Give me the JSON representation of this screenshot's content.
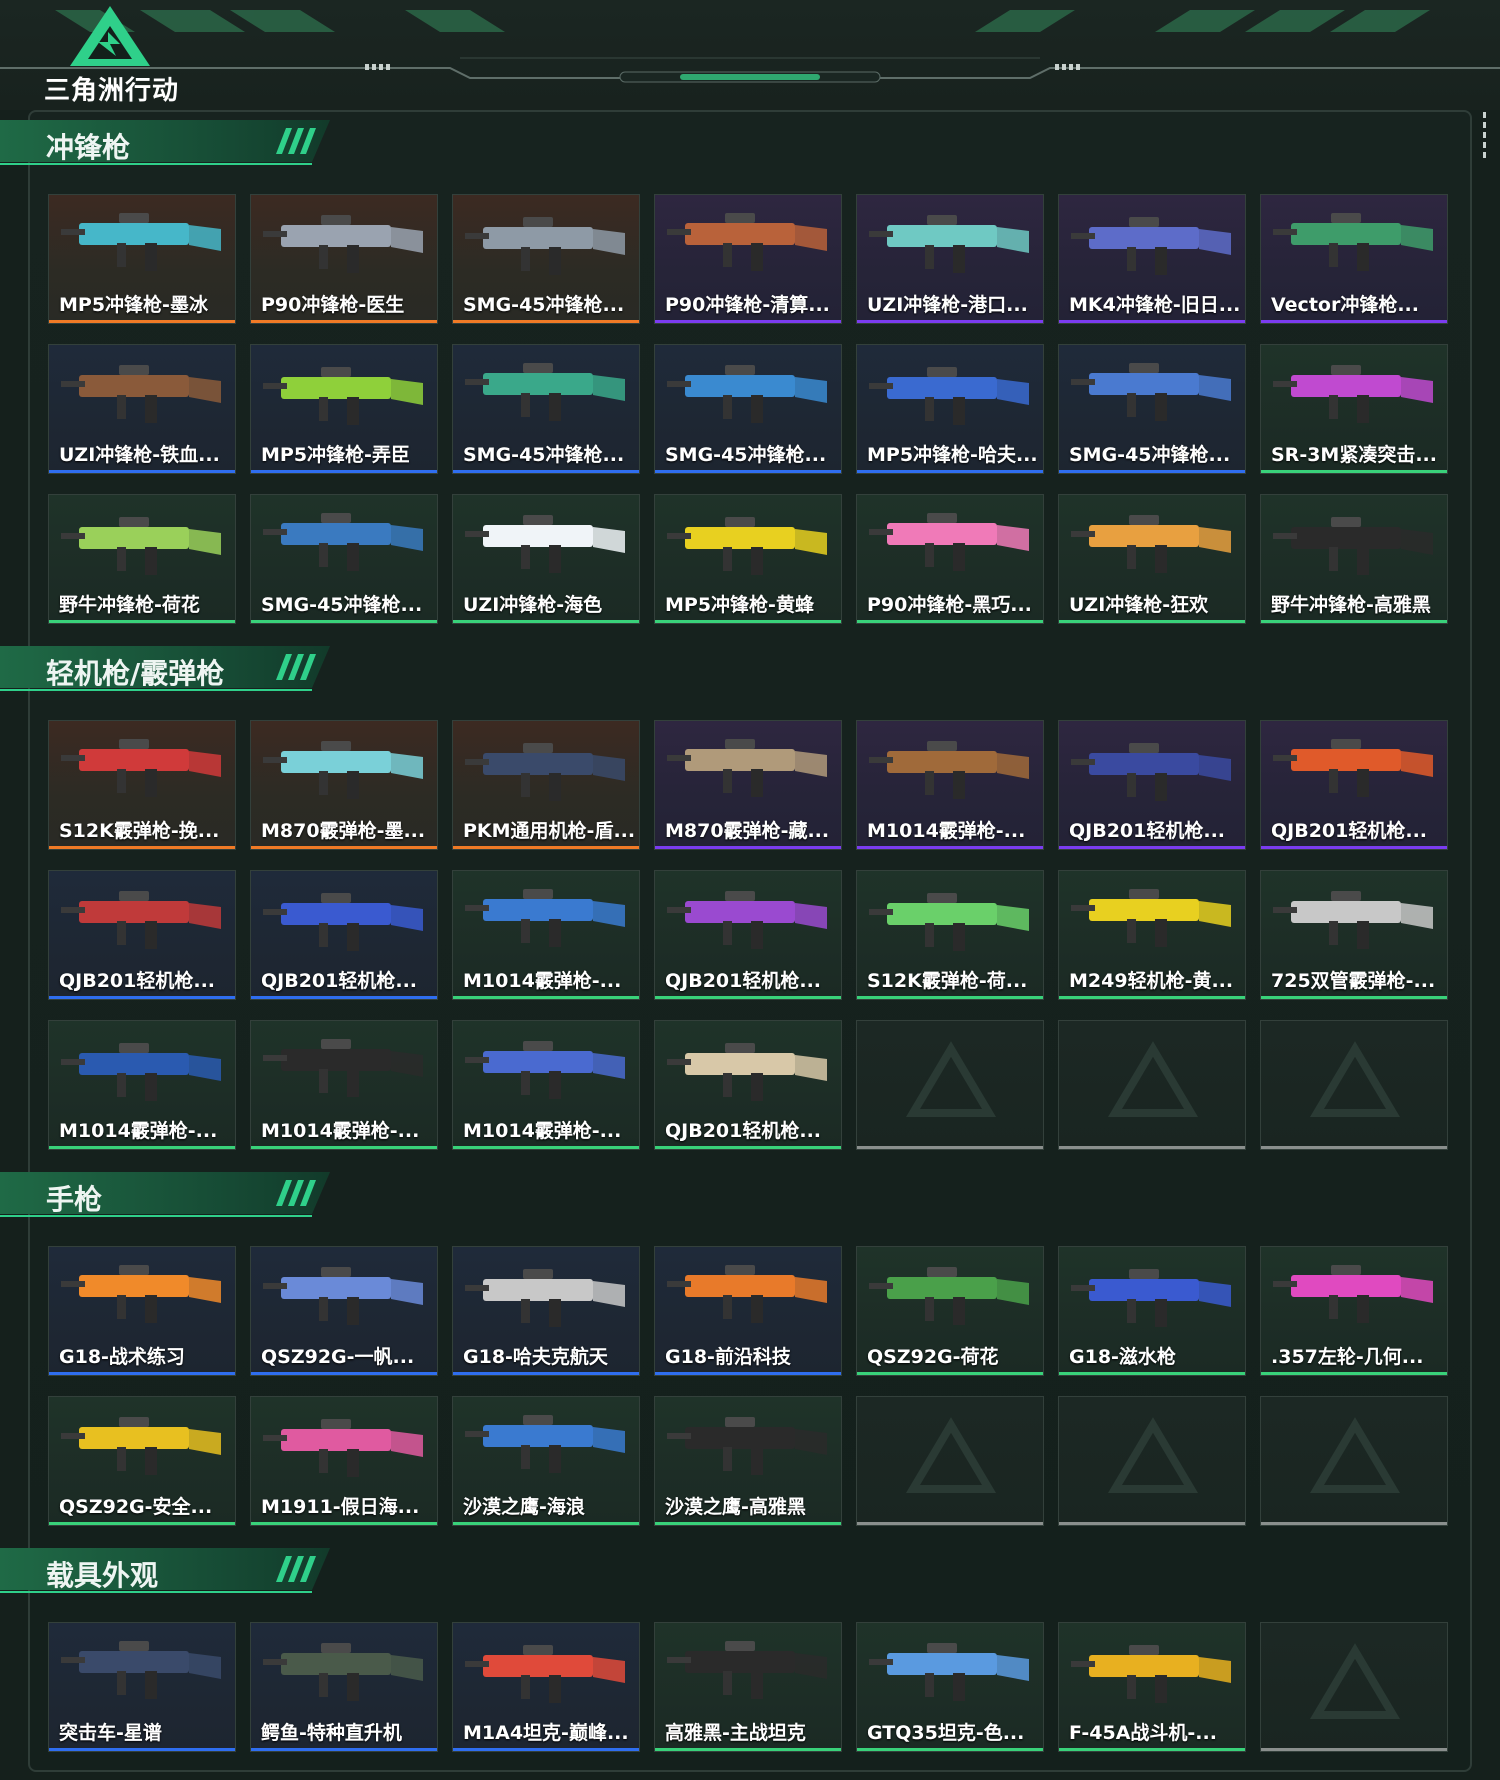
{
  "brand": {
    "logo_text": "三角洲行动"
  },
  "sections": [
    {
      "title": "冲锋枪",
      "items": [
        {
          "label": "MP5冲锋枪-墨冰",
          "rarity": "orange",
          "color": "#46b7c9"
        },
        {
          "label": "P90冲锋枪-医生",
          "rarity": "orange",
          "color": "#9aa3b0"
        },
        {
          "label": "SMG-45冲锋枪...",
          "rarity": "orange",
          "color": "#8e9aa6"
        },
        {
          "label": "P90冲锋枪-清算...",
          "rarity": "purple",
          "color": "#b9623a"
        },
        {
          "label": "UZI冲锋枪-港口...",
          "rarity": "purple",
          "color": "#6fc9c3"
        },
        {
          "label": "MK4冲锋枪-旧日...",
          "rarity": "purple",
          "color": "#5d6cc9"
        },
        {
          "label": "Vector冲锋枪...",
          "rarity": "purple",
          "color": "#3e9c6a"
        },
        {
          "label": "UZI冲锋枪-铁血...",
          "rarity": "blue",
          "color": "#8a5a3a"
        },
        {
          "label": "MP5冲锋枪-弄臣",
          "rarity": "blue",
          "color": "#8fd03a"
        },
        {
          "label": "SMG-45冲锋枪...",
          "rarity": "blue",
          "color": "#3aa88a"
        },
        {
          "label": "SMG-45冲锋枪...",
          "rarity": "blue",
          "color": "#3a8ad0"
        },
        {
          "label": "MP5冲锋枪-哈夫...",
          "rarity": "blue",
          "color": "#3a6ad0"
        },
        {
          "label": "SMG-45冲锋枪...",
          "rarity": "blue",
          "color": "#4a7ad0"
        },
        {
          "label": "SR-3M紧凑突击...",
          "rarity": "green",
          "color": "#c04ad0"
        },
        {
          "label": "野牛冲锋枪-荷花",
          "rarity": "green",
          "color": "#9ad05a"
        },
        {
          "label": "SMG-45冲锋枪...",
          "rarity": "green",
          "color": "#3a7ac0"
        },
        {
          "label": "UZI冲锋枪-海色",
          "rarity": "green",
          "color": "#f0f4f8"
        },
        {
          "label": "MP5冲锋枪-黄蜂",
          "rarity": "green",
          "color": "#e8d020"
        },
        {
          "label": "P90冲锋枪-黑巧...",
          "rarity": "green",
          "color": "#f07ab8"
        },
        {
          "label": "UZI冲锋枪-狂欢",
          "rarity": "green",
          "color": "#e8a040"
        },
        {
          "label": "野牛冲锋枪-高雅黑",
          "rarity": "green",
          "color": "#2a2a2a"
        }
      ]
    },
    {
      "title": "轻机枪/霰弹枪",
      "items": [
        {
          "label": "S12K霰弹枪-挽...",
          "rarity": "orange",
          "color": "#d03a3a"
        },
        {
          "label": "M870霰弹枪-墨...",
          "rarity": "orange",
          "color": "#7ad0d8"
        },
        {
          "label": "PKM通用机枪-盾...",
          "rarity": "orange",
          "color": "#3a4a6a"
        },
        {
          "label": "M870霰弹枪-藏...",
          "rarity": "purple",
          "color": "#b09a7a"
        },
        {
          "label": "M1014霰弹枪-...",
          "rarity": "purple",
          "color": "#a06a3a"
        },
        {
          "label": "QJB201轻机枪...",
          "rarity": "purple",
          "color": "#3a4aa0"
        },
        {
          "label": "QJB201轻机枪...",
          "rarity": "purple",
          "color": "#e05a2a"
        },
        {
          "label": "QJB201轻机枪...",
          "rarity": "blue",
          "color": "#c03a3a"
        },
        {
          "label": "QJB201轻机枪...",
          "rarity": "blue",
          "color": "#3a5ad0"
        },
        {
          "label": "M1014霰弹枪-...",
          "rarity": "green",
          "color": "#3a7ad0"
        },
        {
          "label": "QJB201轻机枪...",
          "rarity": "green",
          "color": "#9a4ad0"
        },
        {
          "label": "S12K霰弹枪-荷...",
          "rarity": "green",
          "color": "#6ad06a"
        },
        {
          "label": "M249轻机枪-黄...",
          "rarity": "green",
          "color": "#e8d020"
        },
        {
          "label": "725双管霰弹枪-...",
          "rarity": "green",
          "color": "#c8c8c8"
        },
        {
          "label": "M1014霰弹枪-...",
          "rarity": "green",
          "color": "#2a5ab0"
        },
        {
          "label": "M1014霰弹枪-...",
          "rarity": "green",
          "color": "#2a2a2a"
        },
        {
          "label": "M1014霰弹枪-...",
          "rarity": "green",
          "color": "#4a6ad0"
        },
        {
          "label": "QJB201轻机枪...",
          "rarity": "green",
          "color": "#d8c8a8"
        },
        {
          "label": "",
          "rarity": "empty",
          "color": ""
        },
        {
          "label": "",
          "rarity": "empty",
          "color": ""
        },
        {
          "label": "",
          "rarity": "empty",
          "color": ""
        }
      ]
    },
    {
      "title": "手枪",
      "items": [
        {
          "label": "G18-战术练习",
          "rarity": "blue",
          "color": "#f08a2a"
        },
        {
          "label": "QSZ92G-一帆...",
          "rarity": "blue",
          "color": "#6a8ad8"
        },
        {
          "label": "G18-哈夫克航天",
          "rarity": "blue",
          "color": "#c8c8c8"
        },
        {
          "label": "G18-前沿科技",
          "rarity": "blue",
          "color": "#e87a2a"
        },
        {
          "label": "QSZ92G-荷花",
          "rarity": "green",
          "color": "#4aa04a"
        },
        {
          "label": "G18-滋水枪",
          "rarity": "green",
          "color": "#3a5ad0"
        },
        {
          "label": ".357左轮-几何...",
          "rarity": "green",
          "color": "#e04ac0"
        },
        {
          "label": "QSZ92G-安全...",
          "rarity": "green",
          "color": "#e8c020"
        },
        {
          "label": "M1911-假日海...",
          "rarity": "green",
          "color": "#e05aa0"
        },
        {
          "label": "沙漠之鹰-海浪",
          "rarity": "green",
          "color": "#3a7ad0"
        },
        {
          "label": "沙漠之鹰-高雅黑",
          "rarity": "green",
          "color": "#2a2a2a"
        },
        {
          "label": "",
          "rarity": "empty",
          "color": ""
        },
        {
          "label": "",
          "rarity": "empty",
          "color": ""
        },
        {
          "label": "",
          "rarity": "empty",
          "color": ""
        }
      ]
    },
    {
      "title": "载具外观",
      "items": [
        {
          "label": "突击车-星谱",
          "rarity": "blue",
          "color": "#3a4a6a"
        },
        {
          "label": "鳄鱼-特种直升机",
          "rarity": "blue",
          "color": "#4a5a4a"
        },
        {
          "label": "M1A4坦克-巅峰...",
          "rarity": "blue",
          "color": "#e04a3a"
        },
        {
          "label": "高雅黑-主战坦克",
          "rarity": "green",
          "color": "#2a2a2a"
        },
        {
          "label": "GTQ35坦克-色...",
          "rarity": "green",
          "color": "#5a9ae0"
        },
        {
          "label": "F-45A战斗机-...",
          "rarity": "green",
          "color": "#e8b020"
        },
        {
          "label": "",
          "rarity": "empty",
          "color": ""
        }
      ]
    }
  ]
}
